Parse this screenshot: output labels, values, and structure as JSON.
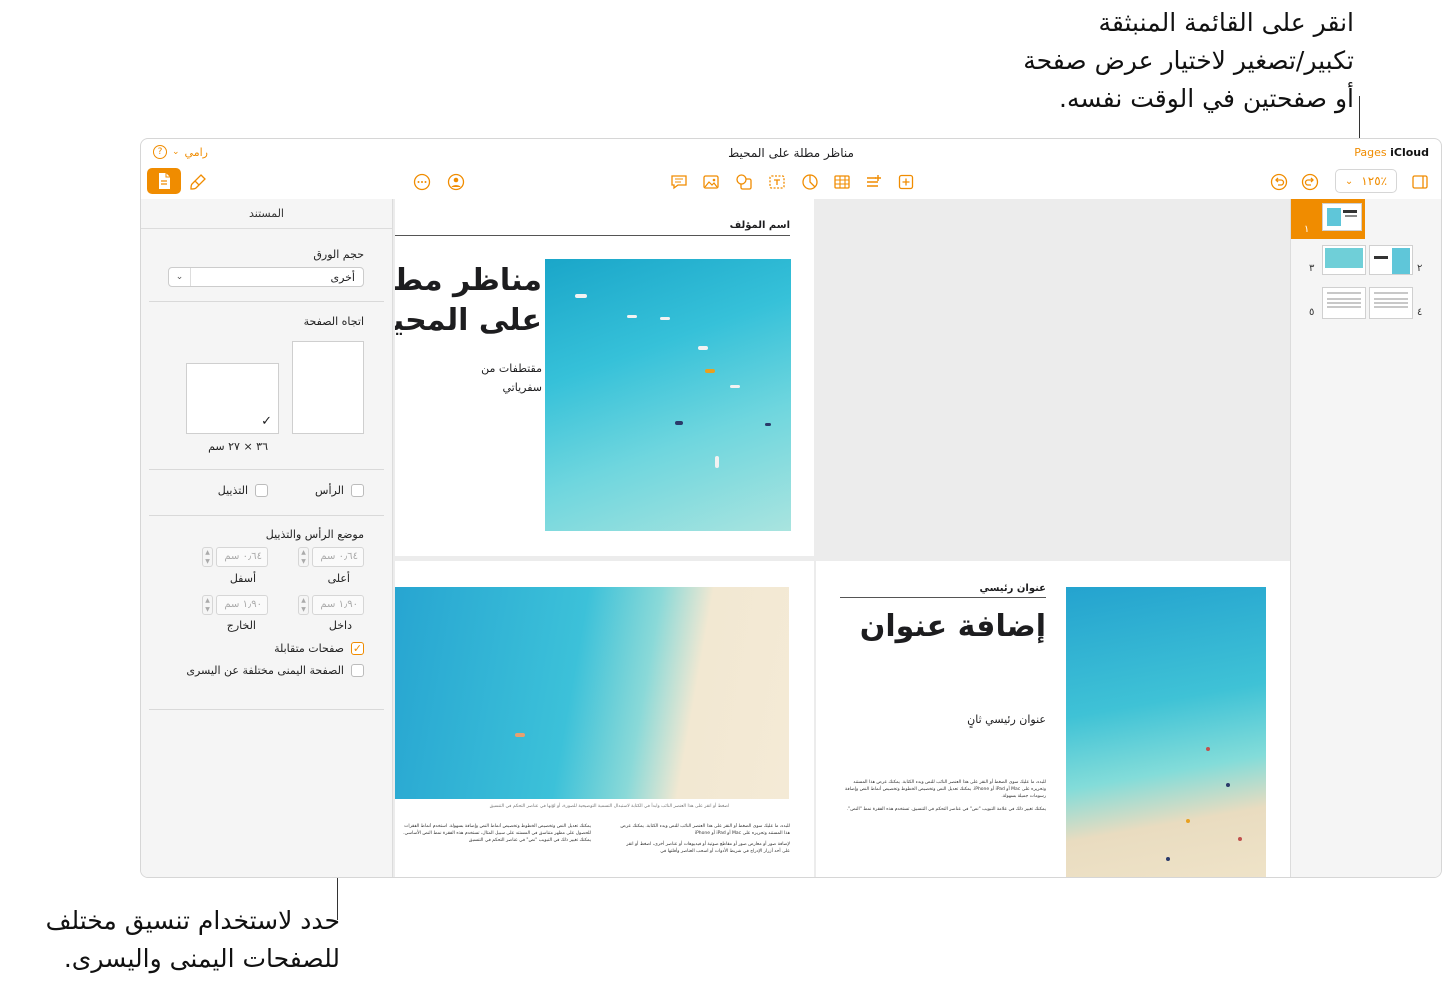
{
  "callouts": {
    "top": [
      "انقر على القائمة المنبثقة",
      "تكبير/تصغير لاختيار عرض صفحة",
      "أو صفحتين في الوقت نفسه."
    ],
    "bottom": [
      "حدد لاستخدام تنسيق مختلف",
      "للصفحات اليمنى واليسرى."
    ]
  },
  "window": {
    "brand_bold": "iCloud",
    "brand_app": "Pages",
    "title": "مناظر مطلة على المحيط",
    "user": "رامي",
    "help_glyph": "?"
  },
  "toolbar": {
    "zoom_value": "٪١٢٥"
  },
  "inspector": {
    "tab": "المستند",
    "paper_size_label": "حجم الورق",
    "paper_size_value": "أخرى",
    "orientation_label": "اتجاه الصفحة",
    "size_text": "٣٦ × ٢٧ سم",
    "header_label": "الرأس",
    "footer_label": "التذييل",
    "position_label": "موضع الرأس والتذييل",
    "top_value": "٠٫٦٤ سم",
    "top_label": "أعلى",
    "bottom_value": "٠٫٦٤ سم",
    "bottom_label": "أسفل",
    "inside_value": "١٫٩٠ سم",
    "inside_label": "داخل",
    "outside_value": "١٫٩٠ سم",
    "outside_label": "الخارج",
    "facing_pages": "صفحات متقابلة",
    "facing_pages_checked": true,
    "different_left_right": "الصفحة اليمنى مختلفة عن اليسرى",
    "different_left_right_checked": false
  },
  "page1": {
    "author": "اسم المؤلف",
    "title_line1": "مناظر مطلة",
    "title_line2": "على المحيط",
    "subtitle_line1": "مقتطفات من",
    "subtitle_line2": "سفرياتي"
  },
  "page2": {
    "caption": "اضغط أو انقر على هذا العنصر النائب وابدأ في الكتابة لاستبدال التسمية التوضيحية للصورة، أو لوّنها في عناصر التحكم في التنسيق",
    "col_right": "للبدء، ما عليك سوى الضغط أو النقر على هذا العنصر النائب للنص وبدء الكتابة. يمكنك عرض هذا المستند وتحريره على Mac أو iPad أو iPhone",
    "col_right_2": "لإضافة صور أو معارض صور أو مقاطع صوتية أو فيديوهات أو عناصر أخرى، اضغط أو انقر على أحد أزرار الإدراج في شريط الأدوات أو اسحب العناصر وأفلتها في",
    "col_left": "يمكنك تعديل النص وتخصيص الخطوط وتخصيص أنماط النص وإضافة بسهولة. استخدم أنماط الفقرات للحصول على مظهر متناسق في المستند على سبيل المثال، تستخدم هذه الفقرة نمط النص الأساسي. يمكنك تغيير ذلك في التبويب \"نص\" في عناصر التحكم في التنسيق"
  },
  "page3": {
    "header": "عنوان رئيسي",
    "title": "إضافة عنوان",
    "subtitle": "عنوان رئيسي ثانٍ",
    "body1": "للبدء، ما عليك سوى الضغط أو النقر على هذا العنصر النائب للنص وبدء الكتابة. يمكنك عرض هذا المستند وتحريره على Mac أو iPad أو iPhone. يمكنك تعديل النص وتخصيص الخطوط وتخصيص أنماط النص وإضافة رسومات جميلة بسهولة.",
    "body2": "يمكنك تغيير ذلك في علامة التبويب \"نص\" في عناصر التحكم في التنسيق. تستخدم هذه الفقرة نمط \"النص\"."
  },
  "thumbnails": [
    "١",
    "٢",
    "٣",
    "٤",
    "٥"
  ],
  "colors": {
    "accent": "#f08c00"
  }
}
